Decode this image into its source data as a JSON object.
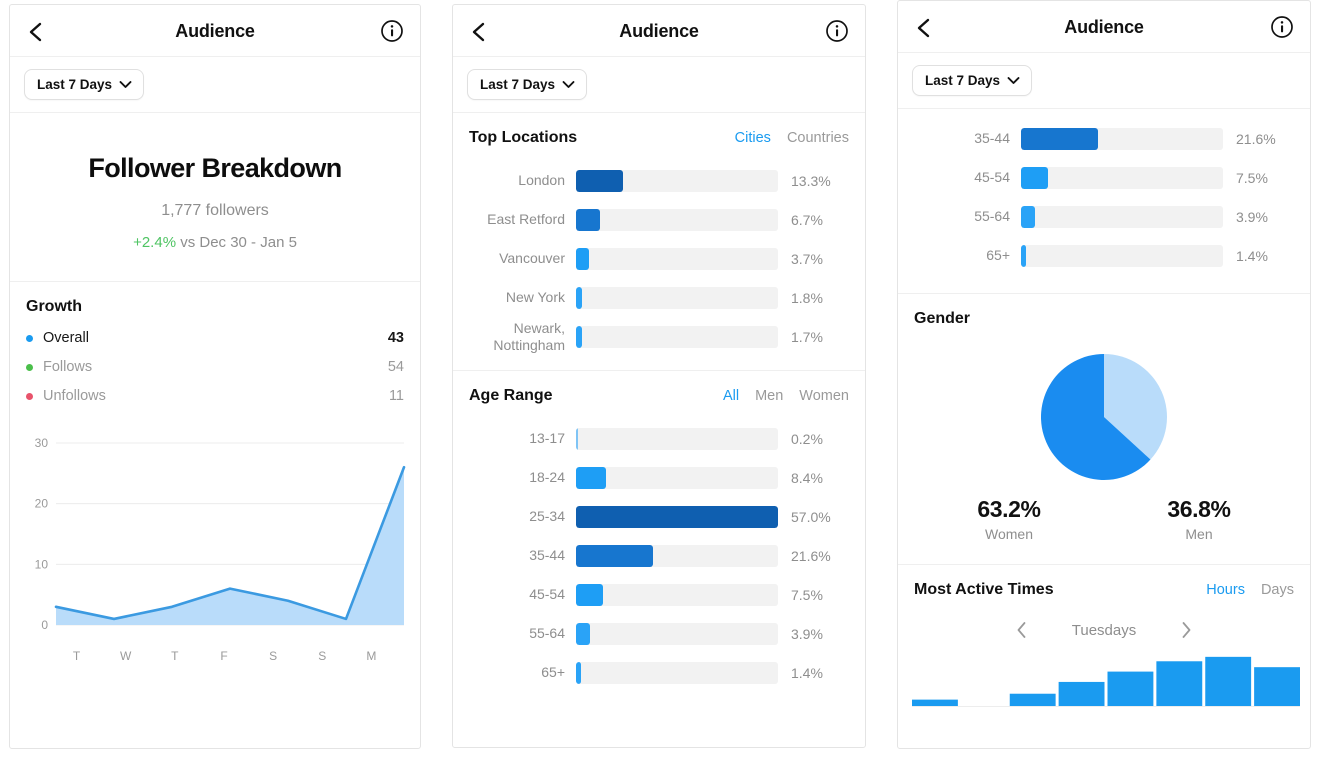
{
  "colors": {
    "accent": "#1a9bf0",
    "accent_dark": "#0f5fb0",
    "accent_mid": "#1776cf",
    "accent_light": "#b9dcfa",
    "green": "#4fc463",
    "red": "#e8536b",
    "track": "#f2f2f2",
    "muted_text": "#8e8e8e"
  },
  "header": {
    "title": "Audience",
    "back_icon": "chevron-left-icon",
    "info_icon": "info-circle-icon"
  },
  "filter": {
    "label": "Last 7 Days",
    "chevron_icon": "chevron-down-icon"
  },
  "panel1": {
    "follower_breakdown": {
      "title": "Follower Breakdown",
      "count": "1,777 followers",
      "delta": "+2.4%",
      "delta_suffix": " vs Dec 30 - Jan 5"
    },
    "growth": {
      "title": "Growth",
      "rows": [
        {
          "label": "Overall",
          "value": "43",
          "dot": "#1a9bf0",
          "emphasis": "primary"
        },
        {
          "label": "Follows",
          "value": "54",
          "dot": "#4bbf4b",
          "emphasis": "muted"
        },
        {
          "label": "Unfollows",
          "value": "11",
          "dot": "#e8536b",
          "emphasis": "muted"
        }
      ]
    },
    "chart_data": {
      "type": "area",
      "title": "Growth",
      "categories": [
        "T",
        "W",
        "T",
        "F",
        "S",
        "S",
        "M"
      ],
      "values": [
        3,
        1,
        3,
        6,
        4,
        1,
        26
      ],
      "ytick_labels": [
        "30",
        "20",
        "10",
        "0"
      ],
      "yticks": [
        30,
        20,
        10,
        0
      ],
      "ylim": [
        0,
        30
      ],
      "xlabel": "",
      "ylabel": "",
      "grid": true,
      "legend": [
        "Overall",
        "Follows",
        "Unfollows"
      ],
      "legend_position": "above-chart",
      "line_color": "#3b9ae1",
      "fill_color": "#b9dcfa"
    }
  },
  "panel2": {
    "top_locations": {
      "title": "Top Locations",
      "tabs": [
        {
          "label": "Cities",
          "active": true
        },
        {
          "label": "Countries",
          "active": false
        }
      ],
      "chart_data": {
        "type": "bar",
        "title": "Top Locations",
        "orientation": "horizontal",
        "categories": [
          "London",
          "East Retford",
          "Vancouver",
          "New York",
          "Newark, Nottingham"
        ],
        "values": [
          13.3,
          6.7,
          3.7,
          1.8,
          1.7
        ],
        "value_labels": [
          "13.3%",
          "6.7%",
          "3.7%",
          "1.8%",
          "1.7%"
        ],
        "bar_colors": [
          "#0f5fb0",
          "#1776cf",
          "#1e9ef5",
          "#2aa3f7",
          "#2aa3f7"
        ],
        "xlim": [
          0,
          57
        ],
        "ylabel": "",
        "xlabel": "",
        "grid": false
      }
    },
    "age_range": {
      "title": "Age Range",
      "tabs": [
        {
          "label": "All",
          "active": true
        },
        {
          "label": "Men",
          "active": false
        },
        {
          "label": "Women",
          "active": false
        }
      ],
      "chart_data": {
        "type": "bar",
        "title": "Age Range",
        "orientation": "horizontal",
        "categories": [
          "13-17",
          "18-24",
          "25-34",
          "35-44",
          "45-54",
          "55-64",
          "65+"
        ],
        "values": [
          0.2,
          8.4,
          57.0,
          21.6,
          7.5,
          3.9,
          1.4
        ],
        "value_labels": [
          "0.2%",
          "8.4%",
          "57.0%",
          "21.6%",
          "7.5%",
          "3.9%",
          "1.4%"
        ],
        "bar_colors": [
          "#2aa3f7",
          "#1e9ef5",
          "#0f5fb0",
          "#1776cf",
          "#1e9ef5",
          "#2aa3f7",
          "#2aa3f7"
        ],
        "xlim": [
          0,
          57
        ],
        "ylabel": "",
        "xlabel": "",
        "grid": false
      }
    }
  },
  "panel3": {
    "age_range_partial": {
      "chart_data": {
        "type": "bar",
        "title": "Age Range",
        "orientation": "horizontal",
        "categories": [
          "35-44",
          "45-54",
          "55-64",
          "65+"
        ],
        "values": [
          21.6,
          7.5,
          3.9,
          1.4
        ],
        "value_labels": [
          "21.6%",
          "7.5%",
          "3.9%",
          "1.4%"
        ],
        "bar_colors": [
          "#1776cf",
          "#1e9ef5",
          "#2aa3f7",
          "#2aa3f7"
        ],
        "xlim": [
          0,
          57
        ],
        "grid": false
      }
    },
    "gender": {
      "title": "Gender",
      "chart_data": {
        "type": "pie",
        "title": "Gender",
        "labels": [
          "Men",
          "Women"
        ],
        "values": [
          36.8,
          63.2
        ],
        "colors": [
          "#b9dcfa",
          "#1a8cf0"
        ],
        "start_angle_deg": 0,
        "direction": "clockwise"
      },
      "stats": [
        {
          "pct": "63.2%",
          "label": "Women"
        },
        {
          "pct": "36.8%",
          "label": "Men"
        }
      ]
    },
    "most_active": {
      "title": "Most Active Times",
      "tabs": [
        {
          "label": "Hours",
          "active": true
        },
        {
          "label": "Days",
          "active": false
        }
      ],
      "day_nav": {
        "prev_icon": "chevron-left-icon",
        "label": "Tuesdays",
        "next_icon": "chevron-right-icon"
      },
      "chart_data": {
        "type": "bar",
        "title": "Most Active Times",
        "orientation": "vertical",
        "categories": [
          "1",
          "2",
          "3",
          "4",
          "5",
          "6",
          "7",
          "8"
        ],
        "values": [
          5,
          0,
          9,
          17,
          24,
          31,
          34,
          27
        ],
        "ylim": [
          0,
          40
        ],
        "bar_color": "#1a9bf0",
        "grid": false,
        "note": "chart is clipped by the bottom of the viewport"
      }
    }
  }
}
